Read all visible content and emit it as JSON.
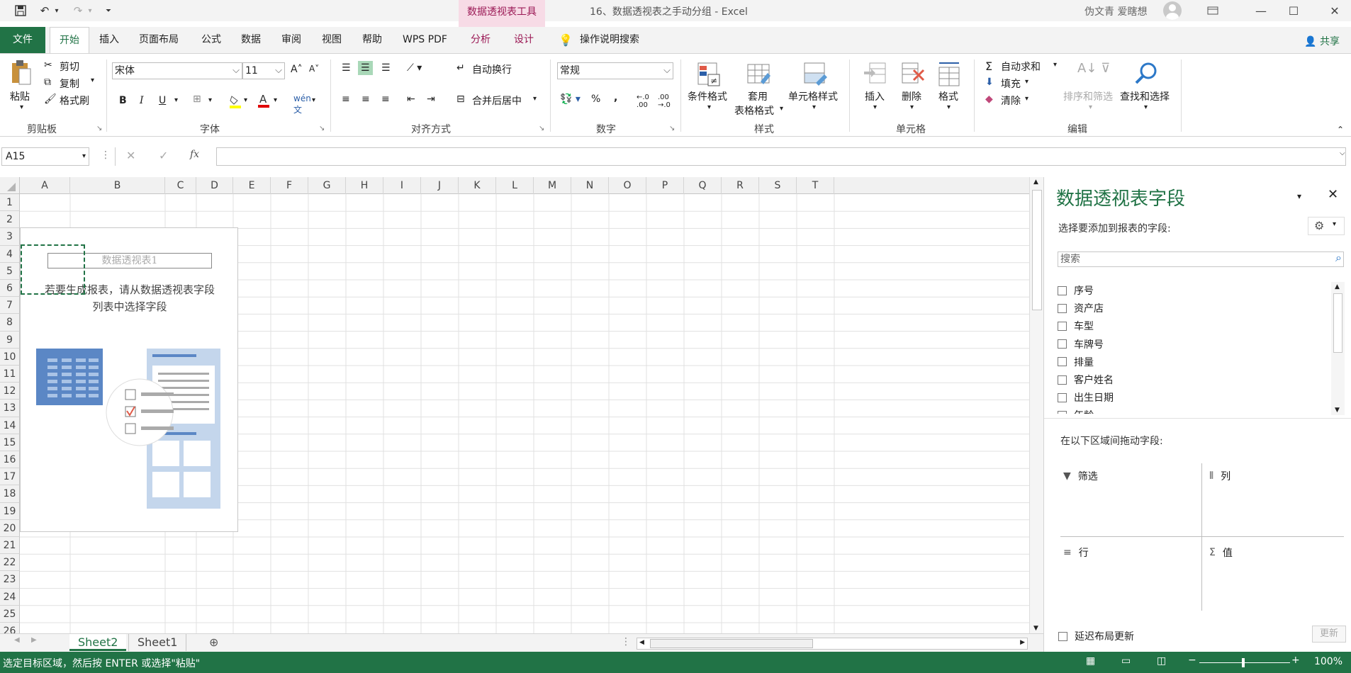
{
  "window": {
    "doc_title": "16、数据透视表之手动分组  -  Excel",
    "context_group": "数据透视表工具",
    "user_name": "伪文青 爱瞎想",
    "share_label": "共享"
  },
  "tabs": [
    "文件",
    "开始",
    "插入",
    "页面布局",
    "公式",
    "数据",
    "审阅",
    "视图",
    "帮助",
    "WPS PDF",
    "分析",
    "设计"
  ],
  "tell_me": "操作说明搜索",
  "ribbon": {
    "paste": "粘贴",
    "cut": "剪切",
    "copy": "复制",
    "format_painter": "格式刷",
    "font_name": "宋体",
    "font_size": "11",
    "wrap_text": "自动换行",
    "merge_center": "合并后居中",
    "number_format": "常规",
    "conditional_format": "条件格式",
    "table_format_1": "套用",
    "table_format_2": "表格格式",
    "cell_styles": "单元格样式",
    "insert": "插入",
    "delete": "删除",
    "format": "格式",
    "autosum": "自动求和",
    "fill": "填充",
    "clear": "清除",
    "sort_filter": "排序和筛选",
    "find_select": "查找和选择",
    "groups": [
      "剪贴板",
      "字体",
      "对齐方式",
      "数字",
      "样式",
      "单元格",
      "编辑"
    ]
  },
  "formula_bar": {
    "name_box": "A15",
    "formula": ""
  },
  "columns": [
    "A",
    "B",
    "C",
    "D",
    "E",
    "F",
    "G",
    "H",
    "I",
    "J",
    "K",
    "L",
    "M",
    "N",
    "O",
    "P",
    "Q",
    "R",
    "S",
    "T"
  ],
  "rows": [
    "1",
    "2",
    "3",
    "4",
    "5",
    "6",
    "7",
    "8",
    "9",
    "10",
    "11",
    "12",
    "13",
    "14",
    "15",
    "16",
    "17",
    "18",
    "19",
    "20",
    "21",
    "22",
    "23",
    "24",
    "25",
    "26"
  ],
  "pivot": {
    "name": "数据透视表1",
    "hint_1": "若要生成报表，请从数据透视表字段",
    "hint_2": "列表中选择字段"
  },
  "sheets": [
    "Sheet2",
    "Sheet1"
  ],
  "pane": {
    "title": "数据透视表字段",
    "subtitle": "选择要添加到报表的字段:",
    "search_placeholder": "搜索",
    "fields": [
      "序号",
      "资产店",
      "车型",
      "车牌号",
      "排量",
      "客户姓名",
      "出生日期",
      "年龄"
    ],
    "drag_label": "在以下区域间拖动字段:",
    "areas": {
      "filter": "筛选",
      "columns": "列",
      "rows": "行",
      "values": "值"
    },
    "defer_update": "延迟布局更新",
    "update": "更新"
  },
  "status": {
    "text": "选定目标区域，然后按 ENTER 或选择\"粘贴\"",
    "zoom": "100%"
  },
  "colors": {
    "accent": "#217346",
    "context": "#9b1955"
  }
}
